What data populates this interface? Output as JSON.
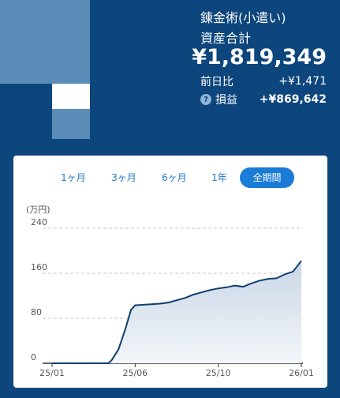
{
  "header": {
    "fund_name": "錬金術(小遣い)",
    "total_label": "資産合計",
    "total_value": "¥1,819,349",
    "day_change_label": "前日比",
    "day_change_value": "+¥1,471",
    "pl_label": "損益",
    "pl_value": "+¥869,642",
    "help_icon_glyph": "?"
  },
  "tabs": [
    {
      "label": "1ヶ月",
      "active": false
    },
    {
      "label": "3ヶ月",
      "active": false
    },
    {
      "label": "6ヶ月",
      "active": false
    },
    {
      "label": "1年",
      "active": false
    },
    {
      "label": "全期間",
      "active": true
    }
  ],
  "colors": {
    "background": "#0d467d",
    "accent": "#1a7cd6",
    "line": "#0d3f70",
    "fill": "#dde6f0"
  },
  "chart_data": {
    "type": "area",
    "unit_label": "(万円)",
    "ylim": [
      0,
      240
    ],
    "y_ticks": [
      0,
      80,
      160,
      240
    ],
    "x_ticks": [
      "25/01",
      "25/06",
      "25/10",
      "26/01"
    ],
    "grid": true,
    "series": [
      {
        "x": [
          0,
          0.2,
          0.4,
          0.6,
          0.68,
          0.72,
          0.8,
          0.88,
          0.95,
          1.0,
          1.1,
          1.2,
          1.3,
          1.4,
          1.5,
          1.6,
          1.7,
          1.8,
          1.9,
          2.0,
          2.1,
          2.2,
          2.3,
          2.4,
          2.5,
          2.6,
          2.7,
          2.8,
          2.9,
          3.0
        ],
        "values": [
          0,
          0,
          0,
          0,
          0,
          6,
          25,
          60,
          95,
          103,
          104,
          105,
          106,
          108,
          112,
          116,
          122,
          126,
          130,
          133,
          135,
          138,
          136,
          142,
          147,
          150,
          151,
          158,
          163,
          182
        ]
      }
    ]
  }
}
